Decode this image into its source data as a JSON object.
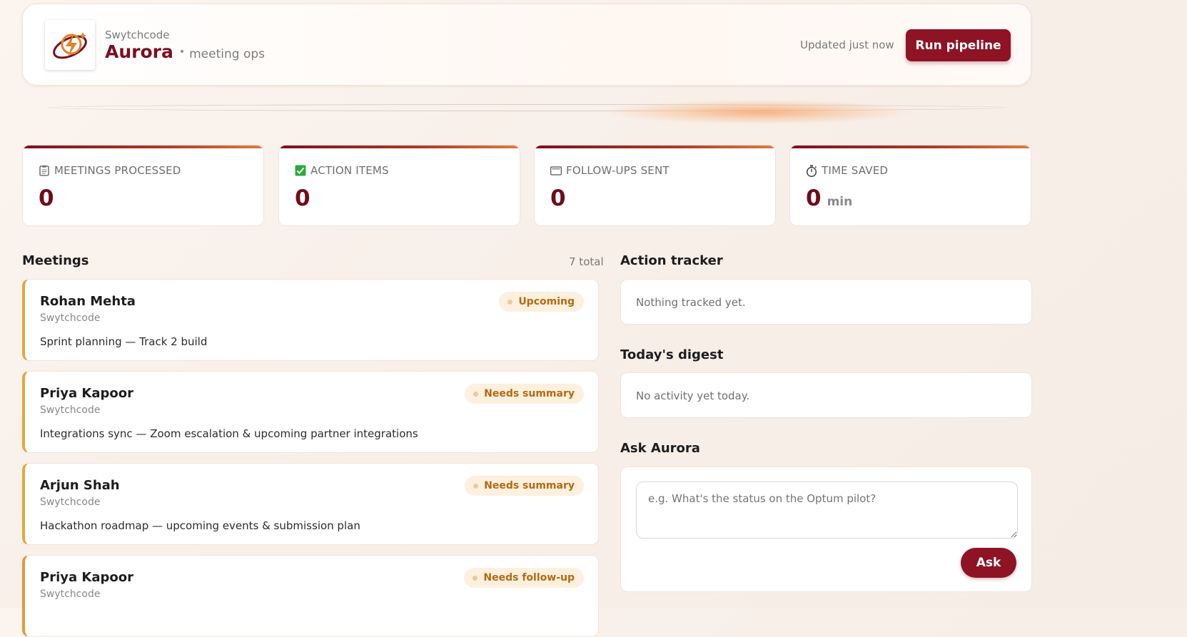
{
  "header": {
    "org": "Swytchcode",
    "brand": "Aurora",
    "separator": "•",
    "subtitle": "meeting ops",
    "updated": "Updated just now",
    "run_label": "Run pipeline",
    "logo_icon": "lightning-orbit-icon"
  },
  "stats": [
    {
      "icon": "clipboard-icon",
      "label": "MEETINGS PROCESSED",
      "value": "0",
      "unit": ""
    },
    {
      "icon": "check-box-icon",
      "label": "ACTION ITEMS",
      "value": "0",
      "unit": ""
    },
    {
      "icon": "envelope-icon",
      "label": "FOLLOW-UPS SENT",
      "value": "0",
      "unit": ""
    },
    {
      "icon": "stopwatch-icon",
      "label": "TIME SAVED",
      "value": "0",
      "unit": "min"
    }
  ],
  "meetings": {
    "title": "Meetings",
    "total": "7 total",
    "items": [
      {
        "name": "Rohan Mehta",
        "org": "Swytchcode",
        "desc": "Sprint planning — Track 2 build",
        "status": "Upcoming"
      },
      {
        "name": "Priya Kapoor",
        "org": "Swytchcode",
        "desc": "Integrations sync — Zoom escalation & upcoming partner integrations",
        "status": "Needs summary"
      },
      {
        "name": "Arjun Shah",
        "org": "Swytchcode",
        "desc": "Hackathon roadmap — upcoming events & submission plan",
        "status": "Needs summary"
      },
      {
        "name": "Priya Kapoor",
        "org": "Swytchcode",
        "desc": "",
        "status": "Needs follow-up"
      }
    ]
  },
  "tracker": {
    "title": "Action tracker",
    "empty": "Nothing tracked yet."
  },
  "digest": {
    "title": "Today's digest",
    "empty": "No activity yet today."
  },
  "ask": {
    "title": "Ask Aurora",
    "placeholder": "e.g. What's the status on the Optum pilot?",
    "button": "Ask"
  },
  "colors": {
    "accent": "#8e1325",
    "value": "#6e0d1a",
    "meeting_border": "#e4a73b",
    "badge_bg": "#fdf0df",
    "badge_text": "#b46a10"
  }
}
